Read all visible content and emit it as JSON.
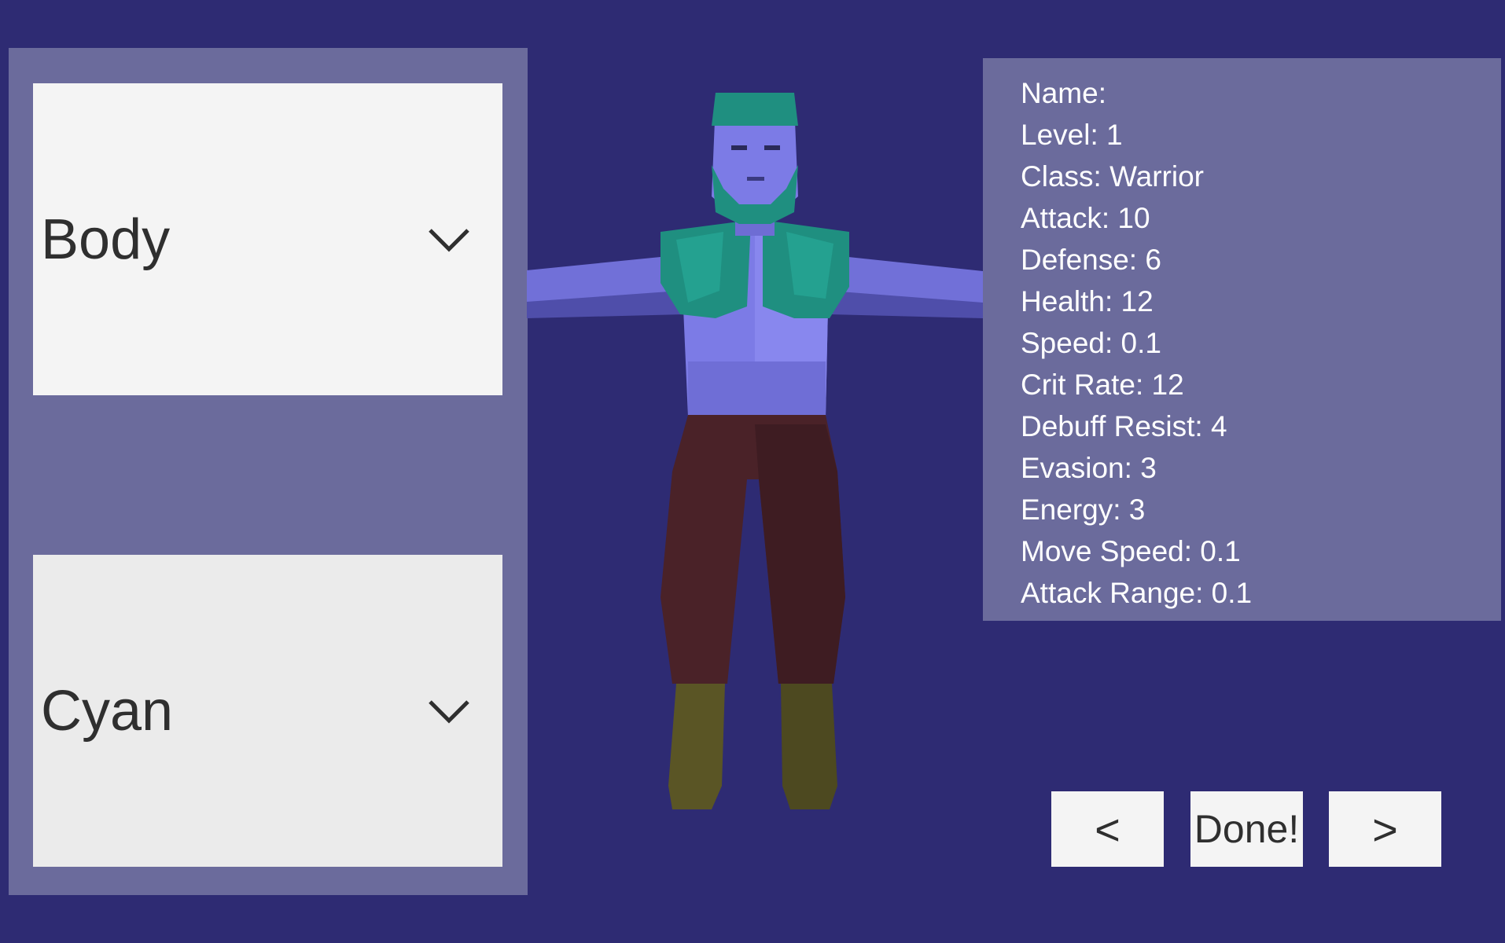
{
  "customization": {
    "part_dropdown": {
      "selected": "Body",
      "icon": "chevron-down-icon"
    },
    "color_dropdown": {
      "selected": "Cyan",
      "icon": "chevron-down-icon"
    }
  },
  "stats": [
    {
      "text": "Name:"
    },
    {
      "text": "Level: 1"
    },
    {
      "text": "Class: Warrior"
    },
    {
      "text": "Attack: 10"
    },
    {
      "text": "Defense: 6"
    },
    {
      "text": "Health: 12"
    },
    {
      "text": "Speed: 0.1"
    },
    {
      "text": "Crit Rate: 12"
    },
    {
      "text": "Debuff Resist: 4"
    },
    {
      "text": "Evasion: 3"
    },
    {
      "text": "Energy: 3"
    },
    {
      "text": "Move Speed: 0.1"
    },
    {
      "text": "Attack Range: 0.1"
    }
  ],
  "buttons": {
    "prev": "<",
    "done": "Done!",
    "next": ">"
  },
  "colors": {
    "background": "#2e2b73",
    "panel": "#6b6b9c",
    "skin": "#7c7be6",
    "hair_beard_fur": "#1f8f80",
    "pants": "#4a2228",
    "boots": "#5a5525"
  }
}
